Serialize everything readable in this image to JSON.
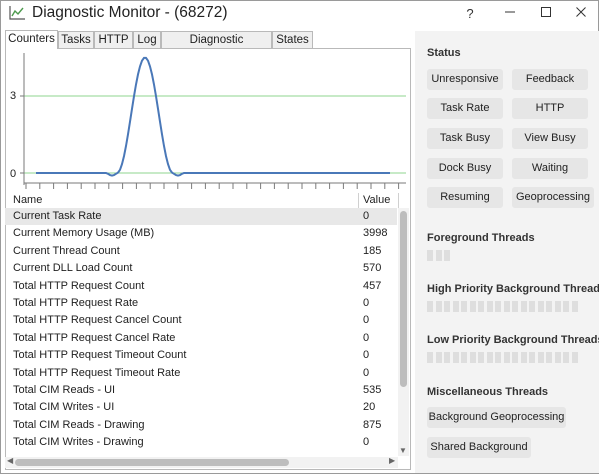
{
  "window": {
    "title": "Diagnostic Monitor - (68272)",
    "controls": {
      "help": "?",
      "minimize": "—",
      "maximize": "☐",
      "close": "✕"
    }
  },
  "tabs": [
    {
      "label": "Counters",
      "active": true
    },
    {
      "label": "Tasks",
      "active": false
    },
    {
      "label": "HTTP",
      "active": false
    },
    {
      "label": "Log",
      "active": false
    },
    {
      "label": "Diagnostic Properties",
      "active": false
    },
    {
      "label": "States",
      "active": false
    }
  ],
  "chart": {
    "y_ticks": [
      "3",
      "0"
    ],
    "colors": {
      "line": "#4a78b8",
      "grid": "#8fd48f",
      "axis": "#7a7a7a"
    },
    "chart_data": {
      "type": "line",
      "y_ticks": [
        0,
        3
      ],
      "peak": 4.5,
      "x_tick_count": 28,
      "grid": true
    }
  },
  "grid": {
    "columns": {
      "name": "Name",
      "value": "Value"
    },
    "rows": [
      {
        "name": "Current Task Rate",
        "value": "0"
      },
      {
        "name": "Current Memory Usage (MB)",
        "value": "3998"
      },
      {
        "name": "Current Thread Count",
        "value": "185"
      },
      {
        "name": "Current DLL Load Count",
        "value": "570"
      },
      {
        "name": "Total HTTP Request Count",
        "value": "457"
      },
      {
        "name": "Total HTTP Request Rate",
        "value": "0"
      },
      {
        "name": "Total HTTP Request Cancel Count",
        "value": "0"
      },
      {
        "name": "Total HTTP Request Cancel Rate",
        "value": "0"
      },
      {
        "name": "Total HTTP Request Timeout Count",
        "value": "0"
      },
      {
        "name": "Total HTTP Request Timeout Rate",
        "value": "0"
      },
      {
        "name": "Total CIM Reads - UI",
        "value": "535"
      },
      {
        "name": "Total CIM Writes - UI",
        "value": "20"
      },
      {
        "name": "Total CIM Reads - Drawing",
        "value": "875"
      },
      {
        "name": "Total CIM Writes - Drawing",
        "value": "0"
      }
    ]
  },
  "status": {
    "label": "Status",
    "buttons": [
      "Unresponsive",
      "Feedback",
      "Task Rate",
      "HTTP",
      "Task Busy",
      "View Busy",
      "Dock Busy",
      "Waiting",
      "Resuming",
      "Geoprocessing"
    ]
  },
  "threads": {
    "foreground": "Foreground Threads",
    "high": "High Priority Background Threads",
    "low": "Low Priority Background Threads",
    "misc": "Miscellaneous Threads",
    "misc_buttons": [
      "Background Geoprocessing",
      "Shared Background"
    ]
  }
}
